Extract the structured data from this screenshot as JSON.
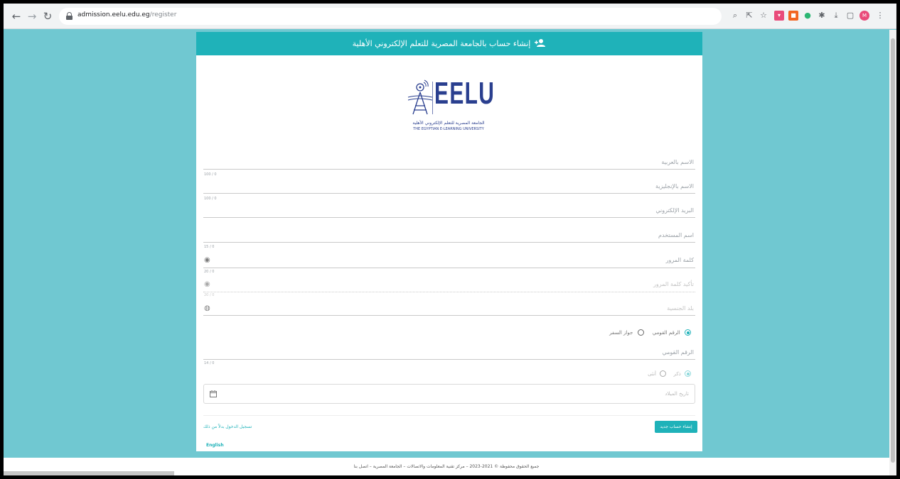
{
  "browser": {
    "url_host": "admission.eelu.edu.eg",
    "url_path": "/register",
    "icons": [
      "back-icon",
      "forward-icon",
      "reload-icon",
      "zoom-icon",
      "share-icon",
      "bookmark-star-icon",
      "extension-icon",
      "profile-avatar-icon"
    ]
  },
  "page": {
    "header_title": "إنشاء حساب بالجامعة المصرية للتعلم الإلكتروني الأهلية",
    "logo_word": "EELU",
    "logo_ar": "الجامعة المصرية للتعلم الإلكتروني الأهلية",
    "logo_en": "THE EGYPTIAN E-LEARNING UNIVERSITY",
    "fields": [
      {
        "label": "الاسم بالعربية",
        "counter": "100 / 0"
      },
      {
        "label": "الاسم بالإنجليزية",
        "counter": "100 / 0"
      },
      {
        "label": "البريد الإلكتروني",
        "counter": ""
      },
      {
        "label": "اسم المستخدم",
        "counter": "15 / 0"
      },
      {
        "label": "كلمة المرور",
        "counter": "20 / 0"
      },
      {
        "label": "تأكيد كلمة المرور",
        "counter": "20 / 0"
      },
      {
        "label": "بلد الجنسية",
        "counter": ""
      }
    ],
    "id_type": {
      "national_id": "الرقم القومي",
      "passport": "جواز السفر"
    },
    "national_id_label": "الرقم القومي",
    "national_id_counter": "14 / 0",
    "gender": {
      "male": "ذكر",
      "female": "أنثى"
    },
    "birth_date_placeholder": "تاريخ الميلاد",
    "create_button": "إنشاء حساب جديد",
    "login_link": "تسجيل الدخول بدلاً من ذلك",
    "language_link": "English",
    "footer_text": "جميع الحقوق محفوظة © 2021-2023 – مركز تقنية المعلومات والاتصالات – الجامعة المصرية – اتصل بنا"
  },
  "colors": {
    "accent": "#1fb2b9",
    "background": "#70c8d1",
    "logo": "#2a3f8f"
  }
}
